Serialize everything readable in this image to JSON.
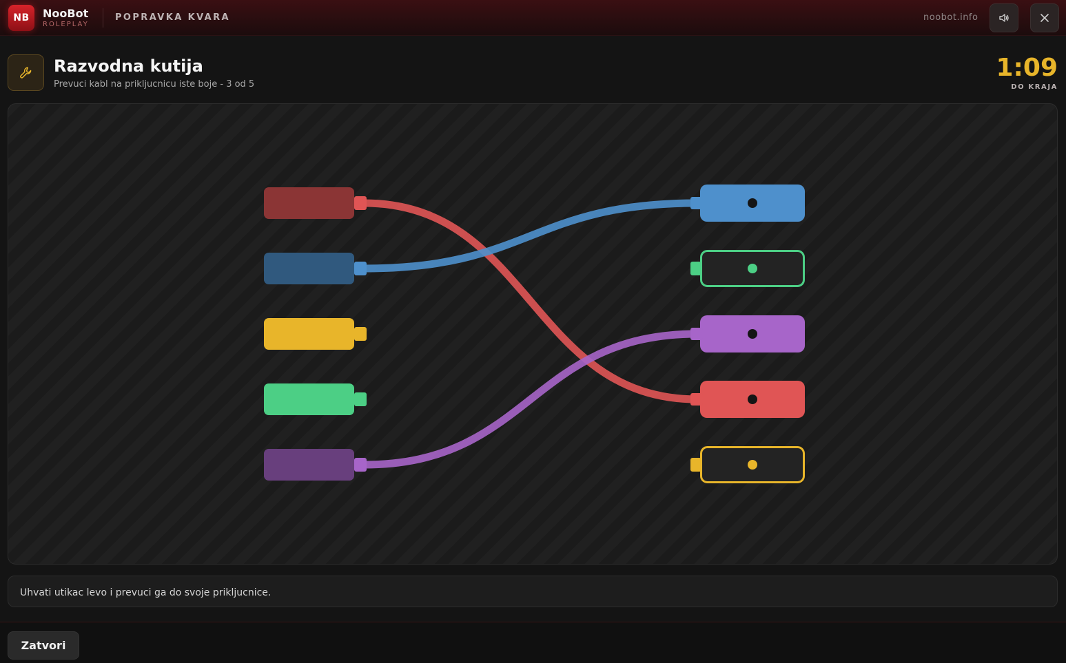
{
  "topbar": {
    "logo_text": "NB",
    "brand_name": "NooBot",
    "brand_sub": "ROLEPLAY",
    "section_title": "POPRAVKA KVARA",
    "site": "noobot.info",
    "sound_icon": "speaker-icon",
    "close_icon": "close-icon"
  },
  "task": {
    "icon": "wrench-icon",
    "title": "Razvodna kutija",
    "subtitle": "Prevuci kabl na prikljucnicu iste boje - 3 od 5",
    "timer": "1:09",
    "timer_label": "DO KRAJA"
  },
  "puzzle": {
    "left_plugs": [
      {
        "color": "red",
        "hex": "#e05555",
        "connected": true
      },
      {
        "color": "blue",
        "hex": "#4e90cc",
        "connected": true
      },
      {
        "color": "yellow",
        "hex": "#e8b52a",
        "connected": false
      },
      {
        "color": "green",
        "hex": "#4ccf85",
        "connected": false
      },
      {
        "color": "purple",
        "hex": "#a765c9",
        "connected": true
      }
    ],
    "right_sockets": [
      {
        "color": "blue",
        "hex": "#4e90cc",
        "filled": true
      },
      {
        "color": "green",
        "hex": "#4ccf85",
        "filled": false
      },
      {
        "color": "purple",
        "hex": "#a765c9",
        "filled": true
      },
      {
        "color": "red",
        "hex": "#e05555",
        "filled": true
      },
      {
        "color": "yellow",
        "hex": "#e8b52a",
        "filled": false
      }
    ],
    "connections": [
      {
        "from": 0,
        "to": 3
      },
      {
        "from": 1,
        "to": 0
      },
      {
        "from": 4,
        "to": 2
      }
    ]
  },
  "hint": "Uhvati utikac levo i prevuci ga do svoje prikljucnice.",
  "footer": {
    "close_label": "Zatvori"
  }
}
